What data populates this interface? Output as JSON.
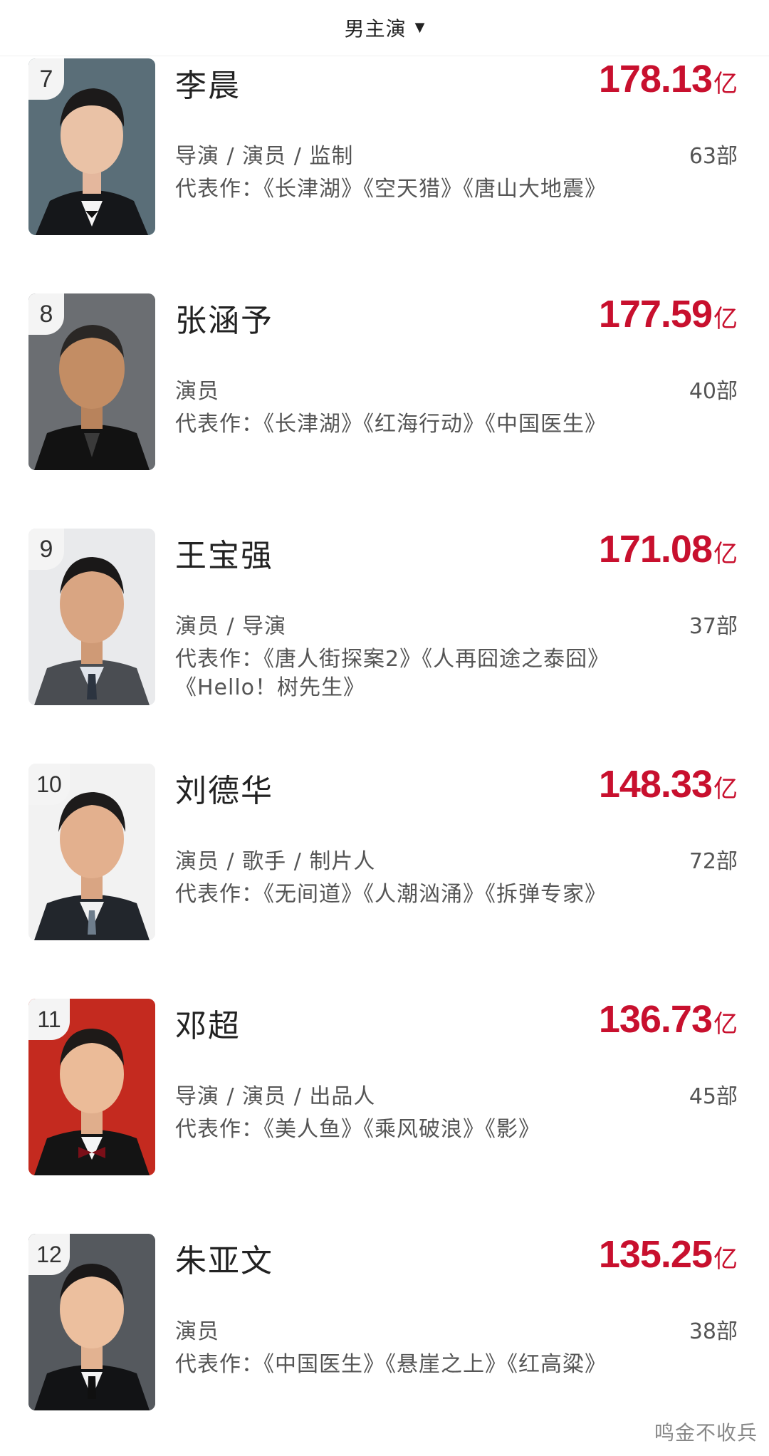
{
  "header": {
    "filter_label": "男主演"
  },
  "actors": [
    {
      "rank": "7",
      "name": "李晨",
      "box_office": "178.13",
      "unit": "亿",
      "roles": "导演 / 演员 / 监制",
      "count": "63部",
      "works": "代表作：《长津湖》《空天猎》《唐山大地震》"
    },
    {
      "rank": "8",
      "name": "张涵予",
      "box_office": "177.59",
      "unit": "亿",
      "roles": "演员",
      "count": "40部",
      "works": "代表作：《长津湖》《红海行动》《中国医生》"
    },
    {
      "rank": "9",
      "name": "王宝强",
      "box_office": "171.08",
      "unit": "亿",
      "roles": "演员 / 导演",
      "count": "37部",
      "works": "代表作：《唐人街探案2》《人再囧途之泰囧》《Hello！树先生》"
    },
    {
      "rank": "10",
      "name": "刘德华",
      "box_office": "148.33",
      "unit": "亿",
      "roles": "演员 / 歌手 / 制片人",
      "count": "72部",
      "works": "代表作：《无间道》《人潮汹涌》《拆弹专家》"
    },
    {
      "rank": "11",
      "name": "邓超",
      "box_office": "136.73",
      "unit": "亿",
      "roles": "导演 / 演员 / 出品人",
      "count": "45部",
      "works": "代表作：《美人鱼》《乘风破浪》《影》"
    },
    {
      "rank": "12",
      "name": "朱亚文",
      "box_office": "135.25",
      "unit": "亿",
      "roles": "演员",
      "count": "38部",
      "works": "代表作：《中国医生》《悬崖之上》《红高粱》"
    }
  ],
  "watermark": "鸣金不收兵",
  "colors": {
    "accent": "#c8102e",
    "text": "#222222",
    "muted": "#555555"
  },
  "icons": {
    "filter_caret": "caret-down-icon"
  }
}
